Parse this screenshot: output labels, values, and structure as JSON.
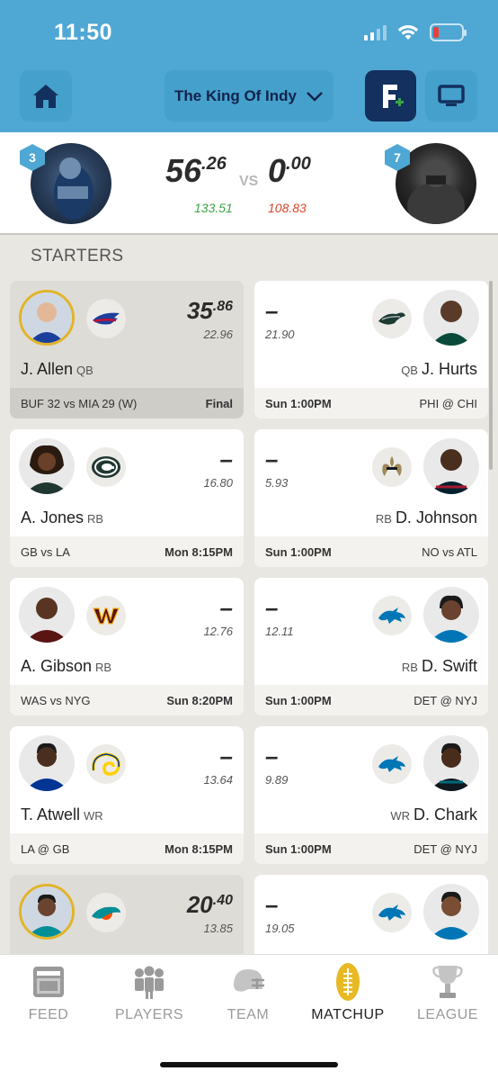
{
  "status_bar": {
    "time": "11:50"
  },
  "header": {
    "league_name": "The King Of Indy"
  },
  "matchup": {
    "left": {
      "rank": "3",
      "score_int": "56",
      "score_dec": ".26",
      "projected": "133.51"
    },
    "vs": "VS",
    "right": {
      "rank": "7",
      "score_int": "0",
      "score_dec": ".00",
      "projected": "108.83"
    }
  },
  "section_title": "STARTERS",
  "rows": [
    {
      "left": {
        "name": "J. Allen",
        "pos": "QB",
        "pts_int": "35",
        "pts_dec": ".86",
        "proj": "22.96",
        "game": "BUF 32 vs MIA 29 (W)",
        "time": "Final",
        "final": true,
        "team_icon": "bills-logo"
      },
      "right": {
        "name": "J. Hurts",
        "pos": "QB",
        "pts": "–",
        "proj": "21.90",
        "game": "PHI @ CHI",
        "time": "Sun 1:00PM",
        "team_icon": "eagles-logo"
      }
    },
    {
      "left": {
        "name": "A. Jones",
        "pos": "RB",
        "pts": "–",
        "proj": "16.80",
        "game": "GB vs LA",
        "time": "Mon 8:15PM",
        "team_icon": "packers-logo"
      },
      "right": {
        "name": "D. Johnson",
        "pos": "RB",
        "pts": "–",
        "proj": "5.93",
        "game": "NO vs ATL",
        "time": "Sun 1:00PM",
        "team_icon": "saints-logo"
      }
    },
    {
      "left": {
        "name": "A. Gibson",
        "pos": "RB",
        "pts": "–",
        "proj": "12.76",
        "game": "WAS vs NYG",
        "time": "Sun 8:20PM",
        "team_icon": "commanders-logo"
      },
      "right": {
        "name": "D. Swift",
        "pos": "RB",
        "pts": "–",
        "proj": "12.11",
        "game": "DET @ NYJ",
        "time": "Sun 1:00PM",
        "team_icon": "lions-logo"
      }
    },
    {
      "left": {
        "name": "T. Atwell",
        "pos": "WR",
        "pts": "–",
        "proj": "13.64",
        "game": "LA @ GB",
        "time": "Mon 8:15PM",
        "team_icon": "rams-logo"
      },
      "right": {
        "name": "D. Chark",
        "pos": "WR",
        "pts": "–",
        "proj": "9.89",
        "game": "DET @ NYJ",
        "time": "Sun 1:00PM",
        "team_icon": "lions-logo"
      }
    },
    {
      "left": {
        "pts_int": "20",
        "pts_dec": ".40",
        "proj": "13.85",
        "team_icon": "dolphins-logo"
      },
      "right": {
        "pts": "–",
        "proj": "19.05",
        "team_icon": "lions-logo"
      }
    }
  ],
  "tabs": [
    {
      "label": "FEED",
      "icon": "feed-icon"
    },
    {
      "label": "PLAYERS",
      "icon": "players-icon"
    },
    {
      "label": "TEAM",
      "icon": "helmet-icon"
    },
    {
      "label": "MATCHUP",
      "icon": "football-icon",
      "active": true
    },
    {
      "label": "LEAGUE",
      "icon": "trophy-icon"
    }
  ],
  "colors": {
    "header_bg": "#4fa7d3",
    "win_green": "#3aa447",
    "loss_red": "#d4462a",
    "badge_gold": "#e2b42a"
  }
}
